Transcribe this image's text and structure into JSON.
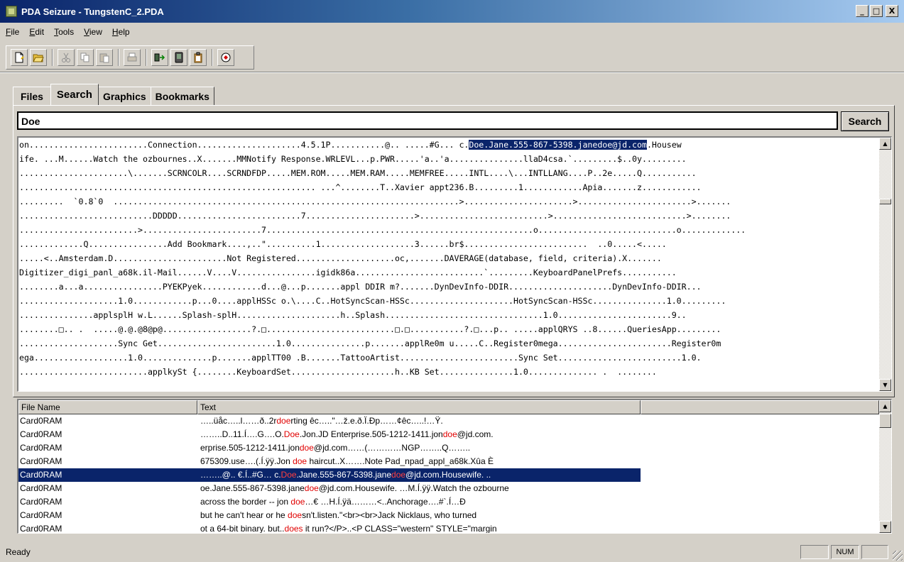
{
  "window": {
    "title": "PDA Seizure - TungstenC_2.PDA",
    "min": "_",
    "max": "□",
    "close": "X"
  },
  "menu": [
    "File",
    "Edit",
    "Tools",
    "View",
    "Help"
  ],
  "toolbar": {
    "buttons": [
      "new-icon",
      "open-icon",
      "cut-icon",
      "copy-icon",
      "paste-icon",
      "print-icon",
      "acquire-icon",
      "device-icon",
      "clipboard-icon",
      "about-icon"
    ]
  },
  "tabs": [
    {
      "label": "Files",
      "active": false
    },
    {
      "label": "Search",
      "active": true
    },
    {
      "label": "Graphics",
      "active": false
    },
    {
      "label": "Bookmarks",
      "active": false
    }
  ],
  "search": {
    "value": "Doe",
    "button": "Search"
  },
  "hexview": {
    "line0_pre": "on........................Connection.....................4.5.1P...........@.. .....#G... c.",
    "line0_hl": "Doe.Jane.555-867-5398.janedoe@jd.com",
    "line0_post": ".Housew",
    "lines": [
      "ife. ...M......Watch the ozbournes..X.......MMNotify Response.WRLEVL...p.PWR.....'a..'a...............llaD4csa.`.........$..0y.........",
      "......................\\.......SCRNCOLR....SCRNDFDP.....MEM.ROM.....MEM.RAM.....MEMFREE.....INTL....\\...INTLLANG....P..2e.....Q...........",
      "............................................................ ...^........T..Xavier appt236.B.........1............Apia.......z............",
      ".........  `0.8`0  ......................................................................>......................>.......................>.......",
      "...........................DDDDD.........................7......................>..........................>...........................>........",
      "........................>........................7......................................................o............................o.............",
      ".............Q................Add Bookmark....,..\"..........1...................3......br$.........................  ..0.....<.....",
      ".....<..Amsterdam.D.......................Not Registered....................oc,.......DAVERAGE(database, field, criteria).X.......",
      "Digitizer_digi_panl_a68k.il-Mail......V....V................igidk86a..........................`.........KeyboardPanelPrefs...........",
      "........a...a................PYEKPyek............d...@...p.......appl DDIR m?.......DynDevInfo-DDIR.....................DynDevInfo-DDIR...",
      "....................1.0............p...0....applHSSc o.\\....C..HotSyncScan-HSSc.....................HotSyncScan-HSSc...............1.0.........",
      "...............applsplH w.L......Splash-splH.....................h..Splash................................1.0.......................9..",
      "........□.. .  .....@.@.@8@p@..................?.□..........................□.□...........?.□...p.. .....applQRYS ..8......QueriesApp.........",
      "....................Sync Get........................1.0...............p.......applRe0m u.....C..Register0mega.......................Register0m",
      "ega...................1.0..............p.......applTT00 .B.......TattooArtist........................Sync Set.........................1.0.",
      "..........................applkySt {........KeyboardSet.....................h..KB Set...............1.0.............. .  ........"
    ]
  },
  "results": {
    "columns": [
      "File Name",
      "Text"
    ],
    "rows": [
      {
        "file": "Card0RAM",
        "pre": "…..üåc…..l……ð..2r",
        "match": "doe",
        "post": "rting êc…..\"…ž.e.ð.Ï.Ðp……¢êc…..!…Ÿ.",
        "selected": false
      },
      {
        "file": "Card0RAM",
        "pre": "……..D..11.Í….G….O.",
        "match": "Doe",
        "post": ".Jon.JD Enterprise.505-1212-1411.jon",
        "match2": "doe",
        "post2": "@jd.com.",
        "selected": false
      },
      {
        "file": "Card0RAM",
        "pre": "erprise.505-1212-1411.jon",
        "match": "doe",
        "post": "@jd.com……(…………NGP……..Q……..",
        "selected": false
      },
      {
        "file": "Card0RAM",
        "pre": "675309.use….(.Í.ÿÿ.Jon ",
        "match": "doe",
        "post": " haircut..X…….Note Pad_npad_appl_a68k.Xûa È",
        "selected": false
      },
      {
        "file": "Card0RAM",
        "pre": "……..@.. €.Í..#G… c.",
        "match": "Doe",
        "post": ".Jane.555-867-5398.jane",
        "match2": "doe",
        "post2": "@jd.com.Housewife. ..",
        "selected": true
      },
      {
        "file": "Card0RAM",
        "pre": "oe.Jane.555-867-5398.jane",
        "match": "doe",
        "post": "@jd.com.Housewife. …M.Í.ÿÿ.Watch the ozbourne",
        "selected": false
      },
      {
        "file": "Card0RAM",
        "pre": "across the border -- jon ",
        "match": "doe",
        "post": "…€ …H.Í.ÿä………<..Anchorage….#`.Í…Ð",
        "selected": false
      },
      {
        "file": "Card0RAM",
        "pre": " but he can't hear or he ",
        "match": "doe",
        "post": "sn't.listen.\"<br><br>Jack Nicklaus, who turned",
        "selected": false
      },
      {
        "file": "Card0RAM",
        "pre": "ot a 64-bit binary. but..",
        "match": "does",
        "post": " it run?</P>..<P CLASS=\"western\" STYLE=\"margin",
        "selected": false
      }
    ]
  },
  "status": {
    "text": "Ready",
    "num": "NUM"
  }
}
